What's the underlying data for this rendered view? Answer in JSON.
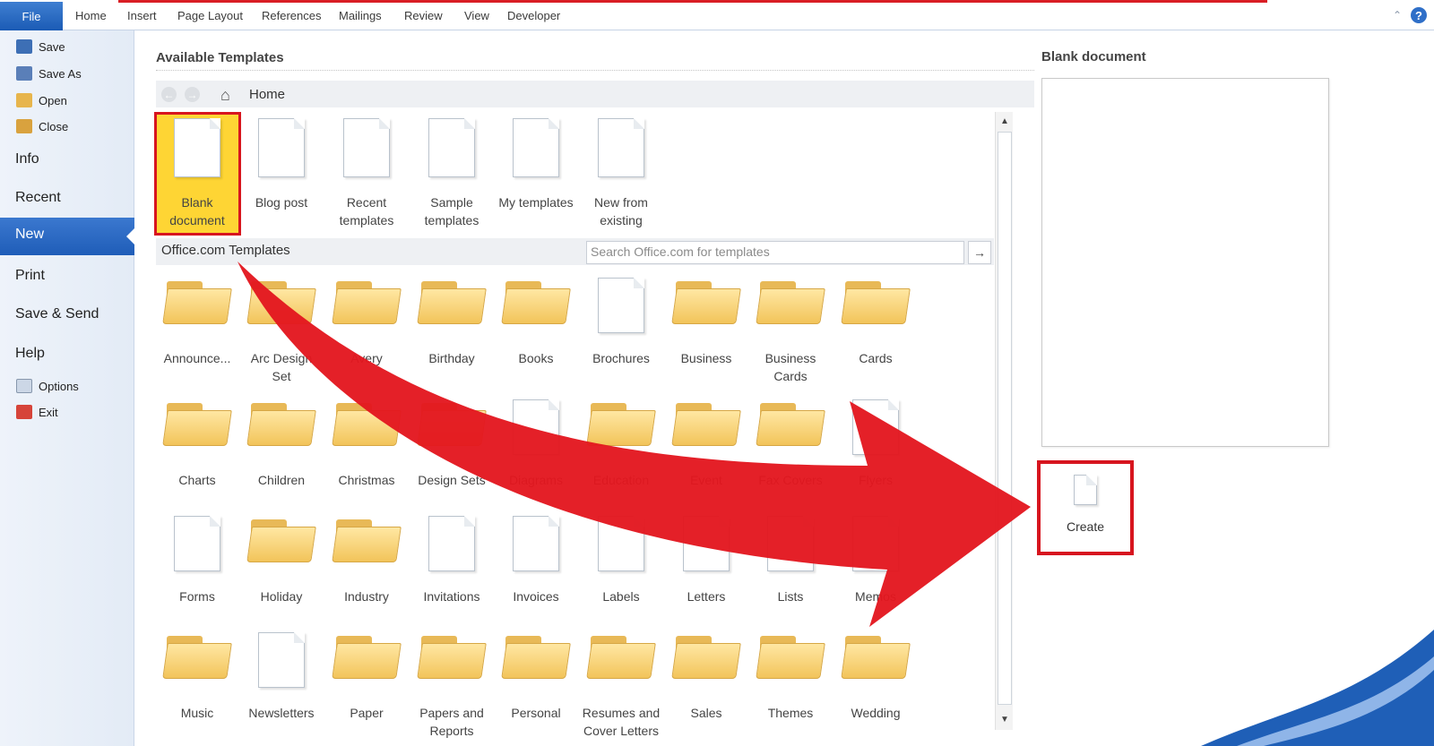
{
  "ribbon": {
    "file_tab": "File",
    "tabs": [
      "Home",
      "Insert",
      "Page Layout",
      "References",
      "Mailings",
      "Review",
      "View",
      "Developer"
    ]
  },
  "nav": {
    "save": "Save",
    "save_as": "Save As",
    "open": "Open",
    "close": "Close",
    "info": "Info",
    "recent": "Recent",
    "new": "New",
    "print": "Print",
    "save_send": "Save & Send",
    "help": "Help",
    "options": "Options",
    "exit": "Exit"
  },
  "main": {
    "title": "Available Templates",
    "home_label": "Home",
    "home_templates": [
      {
        "label": "Blank document",
        "icon": "blank-document-icon"
      },
      {
        "label": "Blog post",
        "icon": "blog-post-icon"
      },
      {
        "label": "Recent templates",
        "icon": "recent-templates-icon"
      },
      {
        "label": "Sample templates",
        "icon": "sample-templates-icon"
      },
      {
        "label": "My templates",
        "icon": "my-templates-icon"
      },
      {
        "label": "New from existing",
        "icon": "new-from-existing-icon"
      }
    ],
    "office_label": "Office.com Templates",
    "search_placeholder": "Search Office.com for templates",
    "office_templates": [
      [
        "Announce...",
        "Arc Design Set",
        "Avery",
        "Birthday",
        "Books",
        "Brochures",
        "Business",
        "Business Cards",
        "Cards"
      ],
      [
        "Charts",
        "Children",
        "Christmas",
        "Design Sets",
        "Diagrams",
        "Education",
        "Event",
        "Fax Covers",
        "Flyers"
      ],
      [
        "Forms",
        "Holiday",
        "Industry",
        "Invitations",
        "Invoices",
        "Labels",
        "Letters",
        "Lists",
        "Memos"
      ],
      [
        "Music",
        "Newsletters",
        "Paper",
        "Papers and Reports",
        "Personal",
        "Resumes and Cover Letters",
        "Sales",
        "Themes",
        "Wedding"
      ]
    ]
  },
  "pane": {
    "title": "Blank document",
    "create_label": "Create"
  }
}
